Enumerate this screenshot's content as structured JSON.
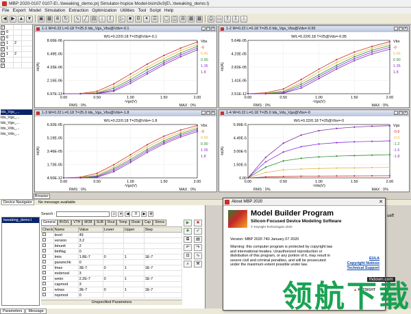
{
  "app": {
    "title": "MBP 2020-0107 0107-E\\..\\tweaking_demo.prj    Simulator-hspice   Model-bsim3v3(E\\..\\tweaking_demo.l)",
    "menu": [
      "File",
      "Export",
      "Model",
      "Simulation",
      "Extraction",
      "Optimization",
      "Utilities",
      "Tool",
      "Script",
      "Help"
    ]
  },
  "left_table": {
    "rows": [
      {
        "checked": "✓",
        "c1": "",
        "c2": ""
      },
      {
        "checked": "✓",
        "c1": "0",
        "c2": ""
      },
      {
        "checked": "✓",
        "c1": "0",
        "c2": ""
      },
      {
        "checked": "✓",
        "c1": "1",
        "c2": "2"
      },
      {
        "checked": "✓",
        "c1": "1",
        "c2": ""
      },
      {
        "checked": "✓",
        "c1": "1",
        "c2": "2"
      },
      {
        "checked": "✓",
        "c1": "",
        "c2": ""
      },
      {
        "checked": "✓",
        "c1": "",
        "c2": ""
      }
    ]
  },
  "tree": {
    "items": [
      "Ids_Vgs_...",
      "Ids_Vgs_...",
      "Ids_Vgs_...",
      "Ids_Vds_...",
      "Ids_Vds_..."
    ]
  },
  "browser_tab": "Browser",
  "plots": [
    {
      "title": "1-1 W=0.22 L=0.18 T=25.0 Ids_Vgs_Vbs@Vds=-0.1",
      "subtitle": "W/L=0.22/0.18   T=25@Vds=-0.1",
      "ylabel": "-Id(A)",
      "xlabel": "-Vgs(V)",
      "yticks": [
        "8.66E-06",
        "6.49E-06",
        "4.33E-06",
        "2.16E-06",
        "6.97E-13"
      ],
      "xticks": [
        "0.00",
        "0.50",
        "1.00",
        "1.50",
        "2.00"
      ],
      "legend_title": "Vbs",
      "legend": [
        "-0",
        "0.45",
        "0.90",
        "1.35",
        "1.8"
      ],
      "rms": "RMS : 0%",
      "max": "MAX : 0%"
    },
    {
      "title": "1-2 W=0.22 L=0.18 T=25.0 Ids_Vgs_Vbs@Vds=-0.95",
      "subtitle": "W/L=0.22/0.18   T=25@Vds=-0.95",
      "ylabel": "-Id(A)",
      "xlabel": "-Vgs(V)",
      "yticks": [
        "5.64E-05",
        "4.23E-05",
        "2.82E-05",
        "1.41E-05",
        "2.51E-12"
      ],
      "xticks": [
        "0.00",
        "0.50",
        "1.00",
        "1.50",
        "2.00"
      ],
      "legend_title": "Vbs",
      "legend": [
        "-0",
        "0.45",
        "0.90",
        "1.35",
        "1.8"
      ],
      "rms": "RMS : 0%",
      "max": "MAX : 0%"
    },
    {
      "title": "1-3 W=0.22 L=0.18 T=25.0 Ids_Vgs_Vbs@Vds=-1.8",
      "subtitle": "W/L=0.22/0.18   T=25@Vds=-1.8",
      "ylabel": "-Id(A)",
      "xlabel": "-Vgs(V)",
      "yticks": [
        "6.92E-05",
        "5.19E-05",
        "3.46E-05",
        "1.73E-05",
        "4.50E-12"
      ],
      "xticks": [
        "0.00",
        "0.50",
        "1.00",
        "1.50",
        "2.00"
      ],
      "legend_title": "Vbs",
      "legend": [
        "-0",
        "0.45",
        "0.90",
        "1.35",
        "1.8"
      ],
      "rms": "RMS : 0%",
      "max": "MAX : 0%"
    },
    {
      "title": "1-4 W=0.22 L=0.18 T=25.0 Ids_Vds_Vgs@Vbs=-0",
      "subtitle": "W/L=0.22/0.18   T=25@Vbs=-0",
      "ylabel": "-Id(A)",
      "xlabel": "-Vds(V)",
      "yticks": [
        "5.99E-5",
        "4.49E-5",
        "3.00E-5",
        "1.50E-5",
        "0.00"
      ],
      "xticks": [
        "0.00",
        "0.50",
        "1.00",
        "1.50",
        "2.00"
      ],
      "legend_title": "Vgs",
      "legend": [
        "-0.6",
        "-0.9",
        "-1.2",
        "-1.5",
        "-1.8"
      ],
      "rms": "RMS : 0%",
      "max": "MAX : 0%"
    }
  ],
  "chart_data": [
    {
      "type": "line",
      "title": "1-1 W=0.22 L=0.18 T=25.0 Ids_Vgs_Vbs@Vds=-0.1",
      "xlabel": "-Vgs(V)",
      "ylabel": "-Id(A)",
      "xlim": [
        0,
        2
      ],
      "ylim": [
        0,
        8.66e-06
      ],
      "x": [
        0,
        0.25,
        0.5,
        0.75,
        1.0,
        1.25,
        1.5,
        1.75,
        2.0
      ],
      "series": [
        {
          "name": "-0",
          "values": [
            0,
            2e-08,
            4e-07,
            1.6e-06,
            3.2e-06,
            4.8e-06,
            6.2e-06,
            7.4e-06,
            8.4e-06
          ]
        },
        {
          "name": "0.45",
          "values": [
            0,
            1e-08,
            2e-07,
            1.2e-06,
            2.7e-06,
            4.3e-06,
            5.7e-06,
            7e-06,
            8e-06
          ]
        },
        {
          "name": "0.90",
          "values": [
            0,
            0.0,
            1e-07,
            9e-07,
            2.3e-06,
            3.9e-06,
            5.3e-06,
            6.6e-06,
            7.7e-06
          ]
        },
        {
          "name": "1.35",
          "values": [
            0,
            0.0,
            5e-08,
            6e-07,
            2e-06,
            3.5e-06,
            5e-06,
            6.3e-06,
            7.4e-06
          ]
        },
        {
          "name": "1.8",
          "values": [
            0,
            0.0,
            2e-08,
            4e-07,
            1.7e-06,
            3.2e-06,
            4.7e-06,
            6e-06,
            7.1e-06
          ]
        }
      ]
    },
    {
      "type": "line",
      "title": "1-2 W=0.22 L=0.18 T=25.0 Ids_Vgs_Vbs@Vds=-0.95",
      "xlabel": "-Vgs(V)",
      "ylabel": "-Id(A)",
      "xlim": [
        0,
        2
      ],
      "ylim": [
        0,
        5.64e-05
      ],
      "x": [
        0,
        0.25,
        0.5,
        0.75,
        1.0,
        1.25,
        1.5,
        1.75,
        2.0
      ],
      "series": [
        {
          "name": "-0",
          "values": [
            0,
            1e-06,
            5e-06,
            1.5e-05,
            2.6e-05,
            3.6e-05,
            4.4e-05,
            5e-05,
            5.5e-05
          ]
        },
        {
          "name": "0.45",
          "values": [
            0,
            5e-07,
            3e-06,
            1.2e-05,
            2.3e-05,
            3.3e-05,
            4.1e-05,
            4.8e-05,
            5.3e-05
          ]
        },
        {
          "name": "0.90",
          "values": [
            0,
            2e-07,
            2e-06,
            1e-05,
            2e-05,
            3e-05,
            3.9e-05,
            4.6e-05,
            5.1e-05
          ]
        },
        {
          "name": "1.35",
          "values": [
            0,
            0.0,
            1e-06,
            8e-06,
            1.8e-05,
            2.8e-05,
            3.7e-05,
            4.4e-05,
            4.9e-05
          ]
        },
        {
          "name": "1.8",
          "values": [
            0,
            0.0,
            5e-07,
            6e-06,
            1.6e-05,
            2.6e-05,
            3.5e-05,
            4.2e-05,
            4.7e-05
          ]
        }
      ]
    },
    {
      "type": "line",
      "title": "1-3 W=0.22 L=0.18 T=25.0 Ids_Vgs_Vbs@Vds=-1.8",
      "xlabel": "-Vgs(V)",
      "ylabel": "-Id(A)",
      "xlim": [
        0,
        2
      ],
      "ylim": [
        0,
        6.92e-05
      ],
      "x": [
        0,
        0.25,
        0.5,
        0.75,
        1.0,
        1.25,
        1.5,
        1.75,
        2.0
      ],
      "series": [
        {
          "name": "-0",
          "values": [
            0,
            1e-06,
            6e-06,
            1.7e-05,
            3e-05,
            4.3e-05,
            5.4e-05,
            6.2e-05,
            6.8e-05
          ]
        },
        {
          "name": "0.45",
          "values": [
            0,
            5e-07,
            4e-06,
            1.4e-05,
            2.7e-05,
            4e-05,
            5.1e-05,
            5.9e-05,
            6.6e-05
          ]
        },
        {
          "name": "0.90",
          "values": [
            0,
            2e-07,
            2.5e-06,
            1.2e-05,
            2.4e-05,
            3.7e-05,
            4.8e-05,
            5.7e-05,
            6.4e-05
          ]
        },
        {
          "name": "1.35",
          "values": [
            0,
            0.0,
            1.5e-06,
            1e-05,
            2.2e-05,
            3.5e-05,
            4.6e-05,
            5.5e-05,
            6.2e-05
          ]
        },
        {
          "name": "1.8",
          "values": [
            0,
            0.0,
            8e-07,
            8e-06,
            2e-05,
            3.3e-05,
            4.4e-05,
            5.3e-05,
            6e-05
          ]
        }
      ]
    },
    {
      "type": "line",
      "title": "1-4 W=0.22 L=0.18 T=25.0 Ids_Vds_Vgs@Vbs=-0",
      "xlabel": "-Vds(V)",
      "ylabel": "-Id(A)",
      "xlim": [
        0,
        2
      ],
      "ylim": [
        0,
        5.99e-05
      ],
      "x": [
        0,
        0.25,
        0.5,
        0.75,
        1.0,
        1.25,
        1.5,
        1.75,
        2.0
      ],
      "series": [
        {
          "name": "-0.6",
          "values": [
            0,
            1e-06,
            1.5e-06,
            1.8e-06,
            2e-06,
            2.1e-06,
            2.2e-06,
            2.3e-06,
            2.4e-06
          ]
        },
        {
          "name": "-0.9",
          "values": [
            0,
            6e-06,
            9e-06,
            1e-05,
            1.05e-05,
            1.1e-05,
            1.12e-05,
            1.15e-05,
            1.18e-05
          ]
        },
        {
          "name": "-1.2",
          "values": [
            0,
            1.2e-05,
            1.9e-05,
            2.2e-05,
            2.35e-05,
            2.45e-05,
            2.5e-05,
            2.55e-05,
            2.6e-05
          ]
        },
        {
          "name": "-1.5",
          "values": [
            0,
            1.8e-05,
            2.9e-05,
            3.5e-05,
            3.8e-05,
            3.95e-05,
            4.05e-05,
            4.1e-05,
            4.15e-05
          ]
        },
        {
          "name": "-1.8",
          "values": [
            0,
            2.3e-05,
            3.9e-05,
            4.8e-05,
            5.3e-05,
            5.55e-05,
            5.7e-05,
            5.8e-05,
            5.85e-05
          ]
        }
      ]
    }
  ],
  "series_colors": [
    "#c8302c",
    "#e6b84a",
    "#2e8b2e",
    "#8a2be2",
    "#7b2fa0"
  ],
  "status": {
    "device_navigator": "Device Navigator",
    "message": "No message available"
  },
  "bottom": {
    "list_item": "tweaking_demo.l",
    "search_label": "Search :",
    "counter": "0",
    "tabs": [
      "General",
      "BVD/L",
      "VTH",
      "MOB",
      "SUB",
      "Rout",
      "Temp",
      "Diode",
      "Cap",
      "Stress"
    ],
    "columns": [
      "Check",
      "Name",
      "Value",
      "Lower",
      "Upper",
      "Step"
    ],
    "rows": [
      {
        "name": "level",
        "value": "49",
        "lower": "",
        "upper": "",
        "step": ""
      },
      {
        "name": "version",
        "value": "3.2",
        "lower": "",
        "upper": "",
        "step": ""
      },
      {
        "name": "binunit",
        "value": "2",
        "lower": "",
        "upper": "",
        "step": ""
      },
      {
        "name": "binflag",
        "value": "0",
        "lower": "",
        "upper": "",
        "step": ""
      },
      {
        "name": "lmin",
        "value": "1.8E-7",
        "lower": "0",
        "upper": "1",
        "step": "1E-7"
      },
      {
        "name": "paramchk",
        "value": "0",
        "lower": "",
        "upper": "",
        "step": ""
      },
      {
        "name": "lmax",
        "value": "3E-7",
        "lower": "0",
        "upper": "1",
        "step": "1E-7"
      },
      {
        "name": "mobmod",
        "value": "3",
        "lower": "",
        "upper": "",
        "step": ""
      },
      {
        "name": "wmin",
        "value": "2.2E-7",
        "lower": "0",
        "upper": "1",
        "step": "1E-7"
      },
      {
        "name": "capmod",
        "value": "3",
        "lower": "",
        "upper": "",
        "step": ""
      },
      {
        "name": "wmax",
        "value": "3E-7",
        "lower": "0",
        "upper": "1",
        "step": "1E-7"
      },
      {
        "name": "nqsmod",
        "value": "0",
        "lower": "",
        "upper": "",
        "step": ""
      }
    ],
    "unspecified": "Unspecified Parameters",
    "footer_tabs": [
      "Parameters",
      "Message"
    ]
  },
  "about": {
    "window_title": "About MBP 2020",
    "product": "Model Builder Program",
    "tagline": "Silicon-Focused Device Modeling Software",
    "copyright": "© Keysight Technologies 2020",
    "version": "Version: MBP 2020 740 January 07 2020",
    "warning": "Warning: this computer program is protected by copyright law and international treaties. Unauthorized reproduction or distribution of this program, or any portion of it, may result in severe civil and criminal penalties, and will be prosecuted under the maximum extent possible under law.",
    "links": [
      "EULA",
      "Copyright Notices",
      "Technical Support"
    ],
    "brand": "KEYSIGHT"
  },
  "right_label": "ueff",
  "watermark": {
    "text": "领航下载",
    "url": "lhdown.com"
  }
}
